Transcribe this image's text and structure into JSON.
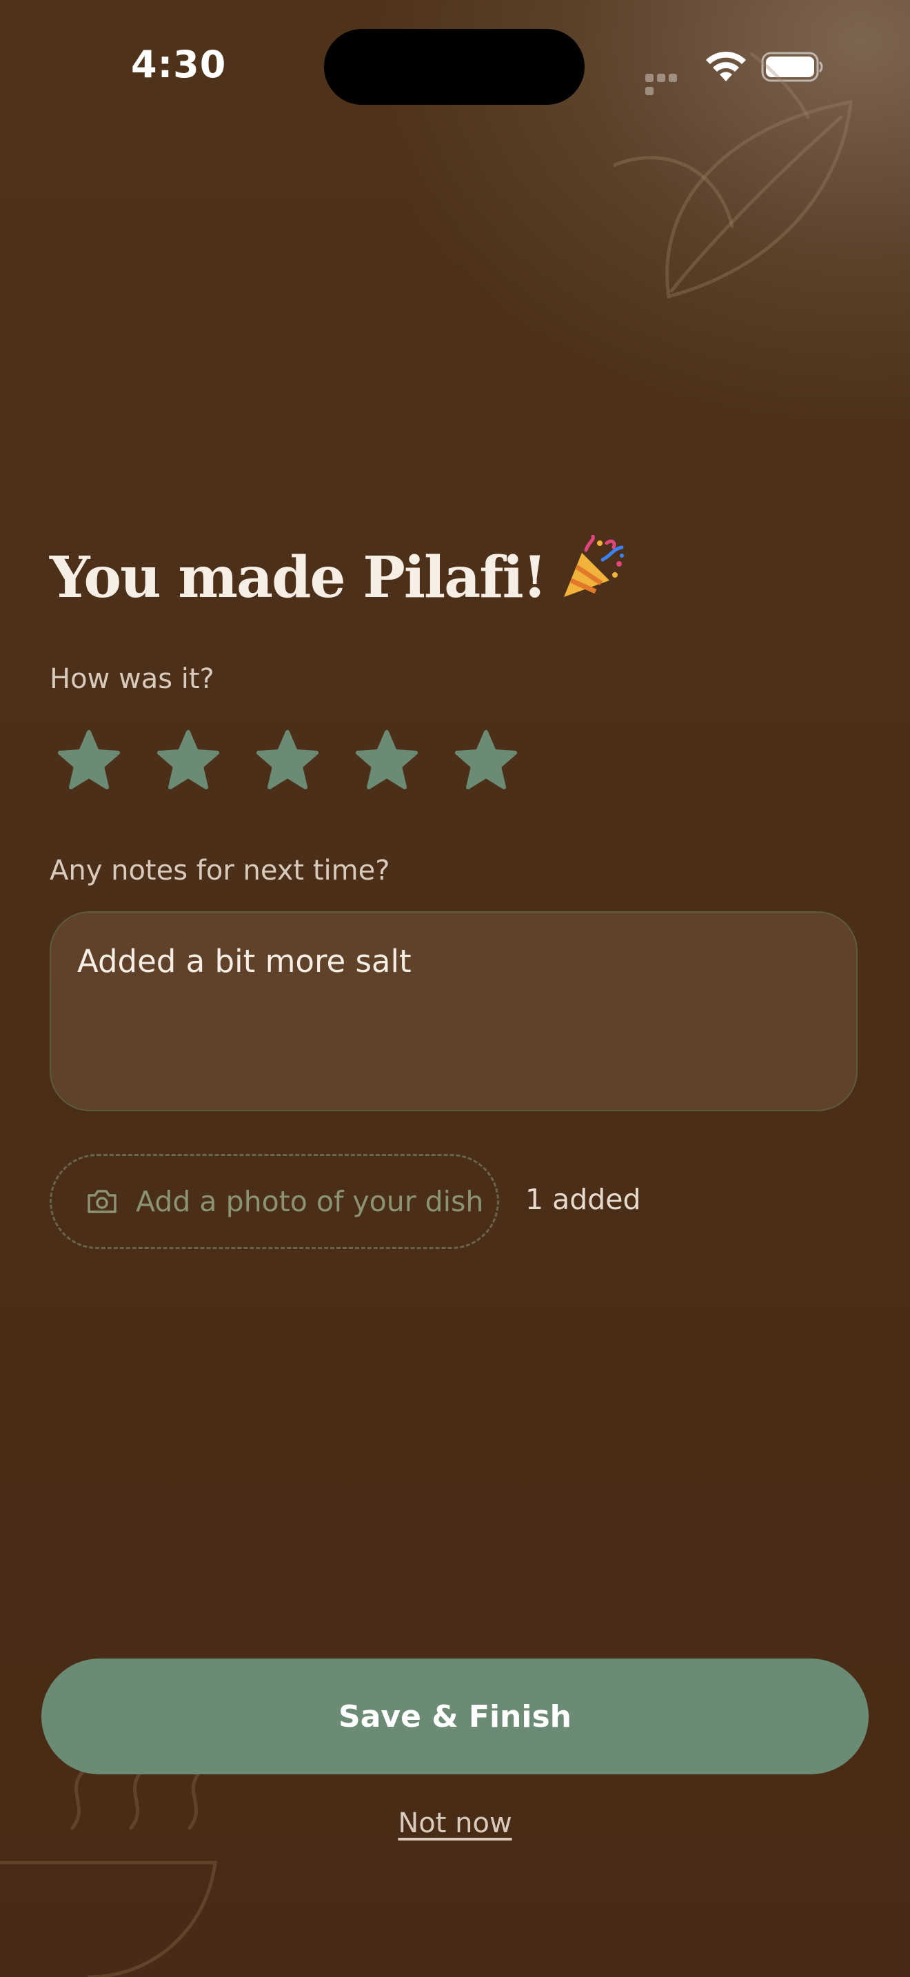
{
  "status_bar": {
    "time": "4:30"
  },
  "main": {
    "headline": "You made Pilafi!",
    "headline_emoji": "party-popper-icon",
    "rating_label": "How was it?",
    "rating": {
      "value": 5,
      "max": 5,
      "star_color": "#6c8b74"
    },
    "notes_label": "Any notes for next time?",
    "notes_value": "Added a bit more salt",
    "photo_button_label": "Add a photo of your dish",
    "photo_count": "1 added"
  },
  "actions": {
    "primary_label": "Save & Finish",
    "secondary_label": "Not now"
  },
  "colors": {
    "accent": "#6c8b74",
    "background": "#4a2d17"
  }
}
